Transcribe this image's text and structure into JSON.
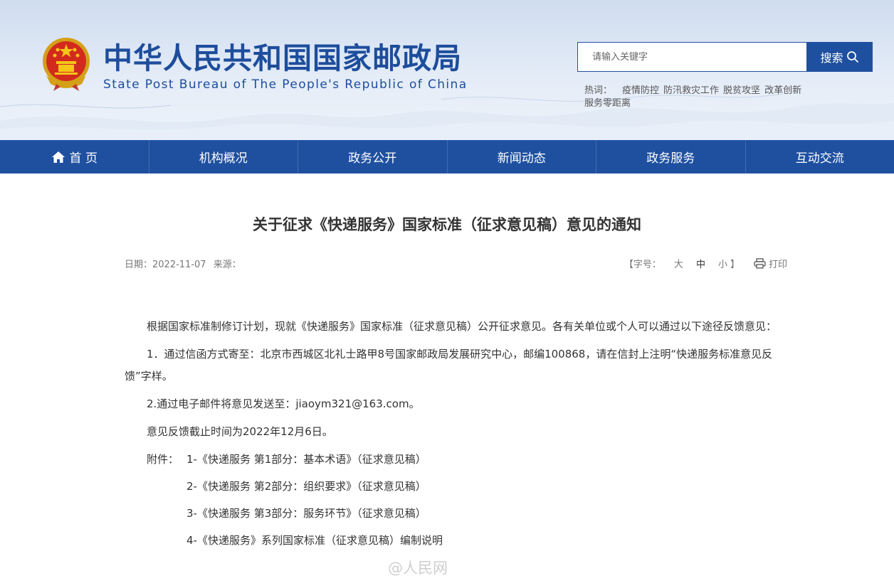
{
  "header": {
    "title_cn": "中华人民共和国国家邮政局",
    "title_en": "State Post Bureau of The People's Republic of China"
  },
  "search": {
    "placeholder": "请输入关键字",
    "button_label": "搜索"
  },
  "hot_words": {
    "label": "热词：",
    "items": [
      "疫情防控",
      "防汛救灾工作",
      "脱贫攻坚",
      "改革创新",
      "服务零距离"
    ]
  },
  "nav": {
    "items": [
      "首 页",
      "机构概况",
      "政务公开",
      "新闻动态",
      "政务服务",
      "互动交流"
    ]
  },
  "article": {
    "title": "关于征求《快递服务》国家标准（征求意见稿）意见的通知",
    "date_label": "日期：2022-11-07",
    "source_label": "来源：",
    "font_size_label": "【字号：",
    "font_sizes": [
      "大",
      "中",
      "小"
    ],
    "bracket_close": "】",
    "print_label": "打印",
    "paragraphs": [
      "根据国家标准制修订计划，现就《快递服务》国家标准（征求意见稿）公开征求意见。各有关单位或个人可以通过以下途径反馈意见：",
      "1．通过信函方式寄至：北京市西城区北礼士路甲8号国家邮政局发展研究中心，邮编100868，请在信封上注明“快递服务标准意见反馈”字样。",
      "2.通过电子邮件将意见发送至：jiaoym321@163.com。",
      "意见反馈截止时间为2022年12月6日。"
    ],
    "attachments_label": "附件：",
    "attachments": [
      "1-《快递服务 第1部分：基本术语》（征求意见稿）",
      "2-《快递服务 第2部分：组织要求》（征求意见稿）",
      "3-《快递服务 第3部分：服务环节》（征求意见稿）",
      "4-《快递服务》系列国家标准（征求意见稿）编制说明"
    ]
  },
  "watermark": "@人民网",
  "colors": {
    "brand_blue": "#1f50a0",
    "title_blue": "#1d4d9c"
  }
}
